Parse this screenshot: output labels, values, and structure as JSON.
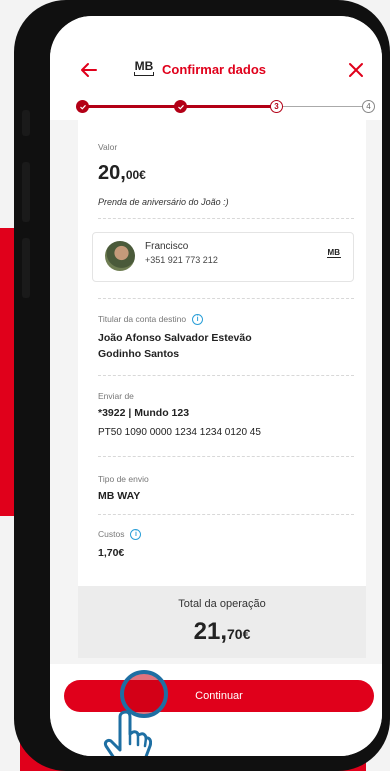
{
  "header": {
    "title": "Confirmar dados",
    "logo_text": "MB",
    "icons": {
      "back": "arrow-left-icon",
      "close": "close-x-icon"
    }
  },
  "stepper": {
    "current_step": "3",
    "next_step": "4",
    "completed_steps": 2
  },
  "transfer": {
    "value_label": "Valor",
    "amount_integer": "20,",
    "amount_decimal": "00€",
    "description": "Prenda de aniversário do João :)"
  },
  "contact": {
    "name": "Francisco",
    "phone": "+351 921 773 212",
    "badge": "MB"
  },
  "destination": {
    "label": "Titular da conta destino",
    "holder_line1": "João Afonso Salvador Estevão",
    "holder_line2": "Godinho Santos"
  },
  "sender": {
    "label": "Enviar de",
    "account": "*3922 | Mundo 123",
    "iban": "PT50 1090 0000 1234 1234  0120 45"
  },
  "send_type": {
    "label": "Tipo de envio",
    "value": "MB WAY"
  },
  "costs": {
    "label": "Custos",
    "value": "1,70€"
  },
  "total": {
    "label": "Total da operação",
    "amount_integer": "21,",
    "amount_decimal": "70€"
  },
  "footer": {
    "continue_label": "Continuar"
  },
  "colors": {
    "brand_red": "#e0001b",
    "stepper_red": "#b30016",
    "info_blue": "#2a9fd8"
  }
}
